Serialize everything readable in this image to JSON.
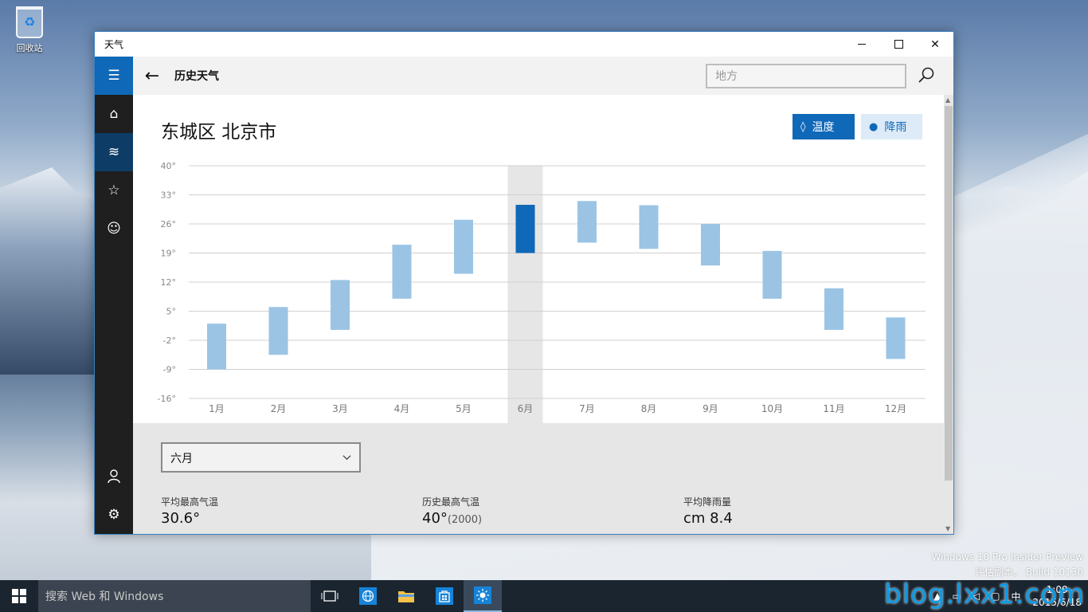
{
  "desktop": {
    "recycle_bin_label": "回收站",
    "watermark_line1": "Windows 10 Pro Insider Preview",
    "watermark_line2": "评估副本。 Build 10130",
    "blog_watermark": "blog.lxx1.com"
  },
  "window": {
    "title": "天气",
    "close_glyph": "✕"
  },
  "nav": {
    "menu_glyph": "☰",
    "home_glyph": "⌂",
    "history_glyph": "≋",
    "favorites_glyph": "☆",
    "emoji_glyph": "☺",
    "account_glyph": "👤",
    "settings_glyph": "⚙"
  },
  "header": {
    "back_glyph": "←",
    "title": "历史天气",
    "search_placeholder": "地方"
  },
  "location": "东城区 北京市",
  "toggles": {
    "temperature": "温度",
    "rain": "降雨",
    "drop_glyph": "💧"
  },
  "chart_data": {
    "type": "bar",
    "subtype": "floating-range",
    "categories": [
      "1月",
      "2月",
      "3月",
      "4月",
      "5月",
      "6月",
      "7月",
      "8月",
      "9月",
      "10月",
      "11月",
      "12月"
    ],
    "series": [
      {
        "low": [
          -9,
          -5.5,
          0.5,
          8,
          14,
          19,
          21.5,
          20,
          16,
          8,
          0.5,
          -6.5
        ],
        "high": [
          2,
          6,
          12.5,
          21,
          27,
          30.6,
          31.5,
          30.5,
          26,
          19.5,
          10.5,
          3.5
        ]
      }
    ],
    "y_ticks": [
      "40°",
      "33°",
      "26°",
      "19°",
      "12°",
      "5°",
      "-2°",
      "-9°",
      "-16°"
    ],
    "y_values": [
      40,
      33,
      26,
      19,
      12,
      5,
      -2,
      -9,
      -16
    ],
    "ylim": [
      -16,
      40
    ],
    "selected_index": 5,
    "grid": true,
    "colors": {
      "bar": "#9bc4e4",
      "selected": "#0f68b8",
      "highlight_band": "#e6e6e6"
    }
  },
  "details": {
    "month_select": "六月",
    "stats": [
      {
        "label": "平均最高气温",
        "value": "30.6°",
        "extra": ""
      },
      {
        "label": "历史最高气温",
        "value": "40°",
        "extra": "(2000)"
      },
      {
        "label": "平均降雨量",
        "value": "cm 8.4",
        "extra": ""
      }
    ]
  },
  "taskbar": {
    "search_text": "搜索 Web 和 Windows",
    "ime": "中",
    "time": "1:09",
    "date": "2015/6/18"
  }
}
